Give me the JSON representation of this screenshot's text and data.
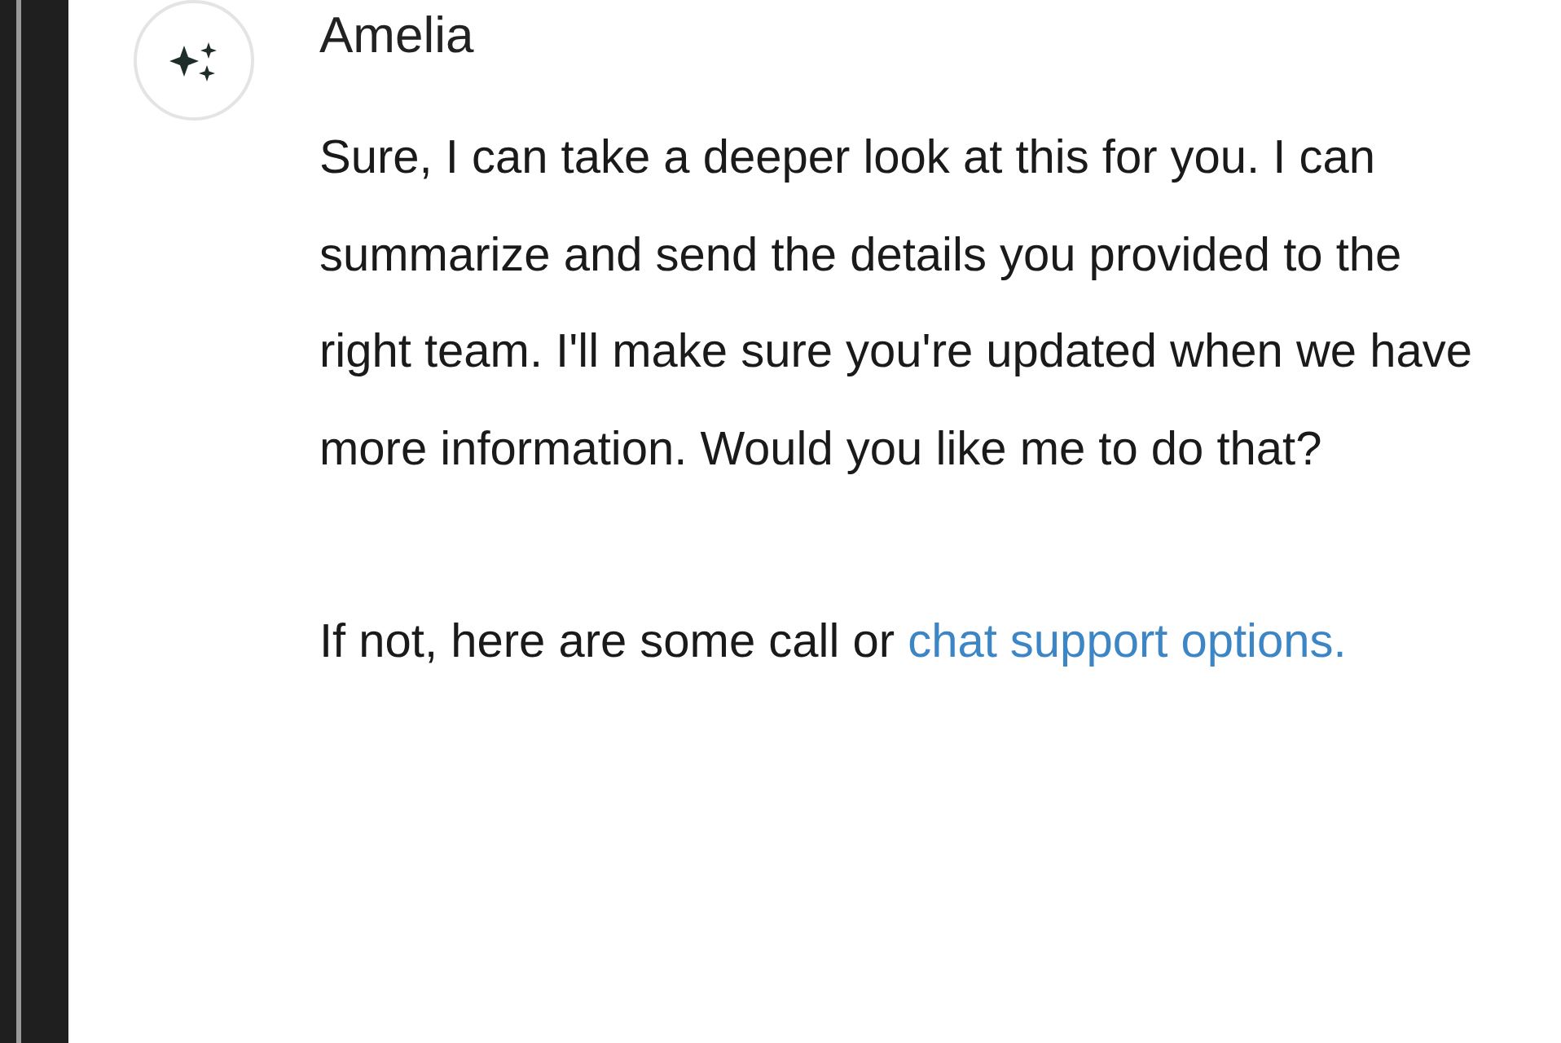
{
  "message": {
    "sender": "Amelia",
    "paragraphs": [
      {
        "text": "Sure, I can take a deeper look at this for you. I can summarize and send the details you provided to the right team. I'll make sure you're updated when we have more information. Would you like me to do that?"
      },
      {
        "text": "If not, here are some call or ",
        "link": "chat support options."
      }
    ]
  }
}
